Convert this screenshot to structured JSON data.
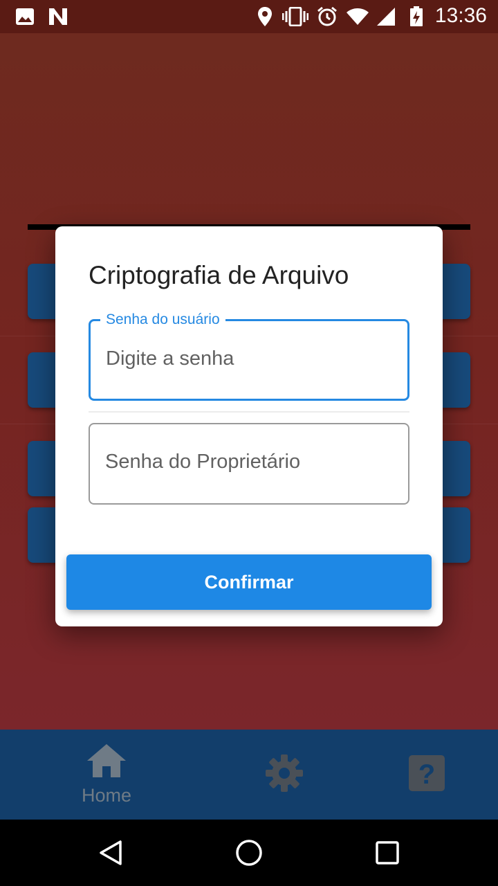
{
  "status_bar": {
    "time": "13:36",
    "icons": [
      "image-icon",
      "n-icon",
      "location-icon",
      "vibrate-icon",
      "alarm-icon",
      "wifi-icon",
      "signal-icon",
      "battery-icon"
    ]
  },
  "dialog": {
    "title": "Criptografia de Arquivo",
    "user_password": {
      "label": "Senha do usuário",
      "placeholder": "Digite a senha"
    },
    "owner_password": {
      "placeholder": "Senha do Proprietário"
    },
    "confirm_label": "Confirmar"
  },
  "bottom_nav": {
    "items": [
      {
        "label": "Home",
        "icon": "home-icon"
      },
      {
        "label": "",
        "icon": "gear-icon"
      },
      {
        "label": "",
        "icon": "help-icon"
      }
    ]
  },
  "system_nav": {
    "icons": [
      "back-icon",
      "home-circle-icon",
      "recents-icon"
    ]
  },
  "colors": {
    "accent": "#1e88e5",
    "background": "#7a2522",
    "nav_background": "#123e6b",
    "status_bar": "#5a1b14"
  }
}
